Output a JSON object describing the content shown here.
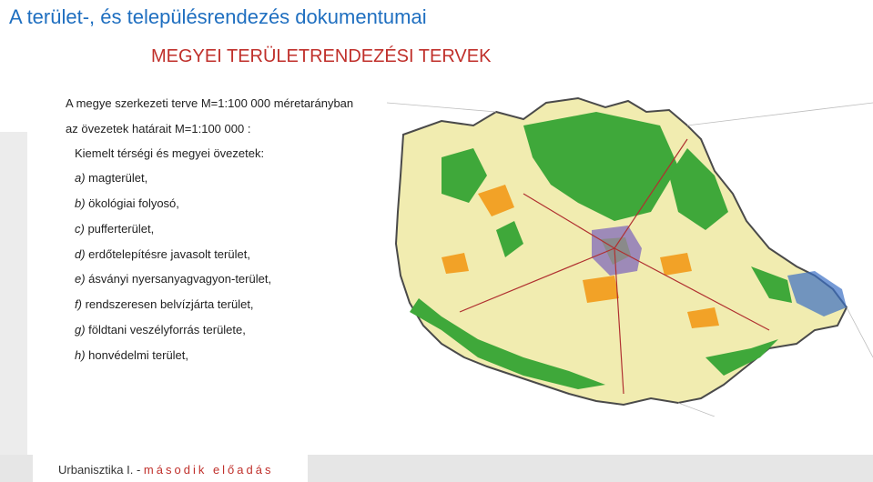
{
  "header": {
    "title": "A terület-, és településrendezés dokumentumai",
    "subtitle": "MEGYEI TERÜLETRENDEZÉSI TERVEK"
  },
  "content": {
    "line1": "A megye szerkezeti terve M=1:100 000 méretarányban",
    "line2": "az övezetek határait M=1:100 000 :",
    "line3": "Kiemelt térségi és megyei övezetek:",
    "items": [
      {
        "marker": "a)",
        "text": " magterület,"
      },
      {
        "marker": "b)",
        "text": " ökológiai folyosó,"
      },
      {
        "marker": "c)",
        "text": " pufferterület,"
      },
      {
        "marker": "d)",
        "text": " erdőtelepítésre javasolt terület,"
      },
      {
        "marker": "e)",
        "text": " ásványi nyersanyagvagyon-terület,"
      },
      {
        "marker": "f)",
        "text": " rendszeresen belvízjárta terület,"
      },
      {
        "marker": "g)",
        "text": " földtani veszélyforrás területe,"
      },
      {
        "marker": "h)",
        "text": " honvédelmi terület,"
      }
    ]
  },
  "map": {
    "colors": {
      "background": "#ffffff",
      "agri": "#f1ecb0",
      "forest": "#3fa83a",
      "orange": "#f2a227",
      "urban": "#9d8ab8",
      "gray": "#8a8a8a",
      "water": "#3b6fc4",
      "border": "#4a4a4a"
    }
  },
  "footer": {
    "course": "Urbanisztika I. - ",
    "lecture": "második előadás"
  },
  "accent_colors": {
    "title": "#1f6fc0",
    "subtitle": "#c0302b"
  }
}
